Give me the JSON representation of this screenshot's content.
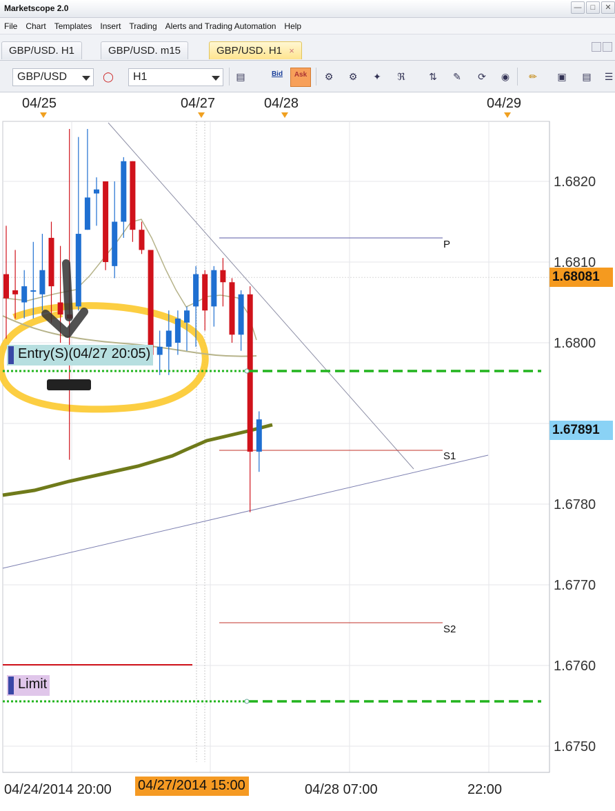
{
  "window": {
    "title": "Marketscope 2.0",
    "buttons": [
      "—",
      "□",
      "✕"
    ]
  },
  "menu": [
    "File",
    "Chart",
    "Templates",
    "Insert",
    "Trading",
    "Alerts and Trading Automation",
    "Help"
  ],
  "tabs": [
    {
      "label": "GBP/USD. H1",
      "active": false
    },
    {
      "label": "GBP/USD. m15",
      "active": false
    },
    {
      "label": "GBP/USD. H1",
      "active": true,
      "close": "×"
    }
  ],
  "toolbar": {
    "symbol": "GBP/USD",
    "period": "H1",
    "bid_label": "Bid",
    "ask_label": "Ask",
    "icons": [
      "line-chart-icon",
      "candle-tool-icon",
      "cursor-tool-icon",
      "zoom-tool-icon",
      "fibonacci-icon",
      "crosshair-icon",
      "alert-icon",
      "refresh-icon",
      "globe-icon",
      "ruler-icon",
      "picture-icon",
      "print-icon",
      "properties-icon"
    ]
  },
  "chart": {
    "top_dates": [
      "04/25",
      "04/27",
      "04/28",
      "04/29"
    ],
    "y_ticks": [
      "1.6820",
      "1.6810",
      "1.6800",
      "1.6780",
      "1.6770",
      "1.6760",
      "1.6750"
    ],
    "bid_price": "1.68081",
    "ask_price": "1.67891",
    "colors": {
      "bid_tag": "#f59a1f",
      "ask_tag": "#8ad2f5",
      "bull": "#1f6fd1",
      "bear": "#d0121b",
      "entry_line": "#22b41e",
      "pivot_line": "#5a5aa6",
      "support_line": "#c0302a",
      "ma_thick": "#6f7a1a",
      "highlight": "#fcc92e"
    },
    "pivot_labels": {
      "p": "P",
      "s1": "S1",
      "s2": "S2"
    },
    "orders": {
      "entry": "Entry(S)(04/27 20:05)",
      "limit": "Limit"
    },
    "x_labels": [
      "04/24/2014 20:00",
      "04/27/2014 15:00",
      "04/28 07:00",
      "22:00"
    ],
    "cursor_time": "04/27/2014 15:00",
    "candles": [
      {
        "o": 1.68085,
        "h": 1.68145,
        "l": 1.68005,
        "c": 1.68055
      },
      {
        "o": 1.68065,
        "h": 1.68115,
        "l": 1.6803,
        "c": 1.6806
      },
      {
        "o": 1.6805,
        "h": 1.6809,
        "l": 1.6803,
        "c": 1.6807
      },
      {
        "o": 1.68065,
        "h": 1.68125,
        "l": 1.6803,
        "c": 1.68065
      },
      {
        "o": 1.6806,
        "h": 1.68135,
        "l": 1.6804,
        "c": 1.6809
      },
      {
        "o": 1.6813,
        "h": 1.6815,
        "l": 1.68025,
        "c": 1.6807
      },
      {
        "o": 1.6805,
        "h": 1.6812,
        "l": 1.68,
        "c": 1.68035
      },
      {
        "o": 1.68035,
        "h": 1.68265,
        "l": 1.67855,
        "c": 1.6803
      },
      {
        "o": 1.68045,
        "h": 1.68255,
        "l": 1.6804,
        "c": 1.68135
      },
      {
        "o": 1.6814,
        "h": 1.68265,
        "l": 1.6814,
        "c": 1.6818
      },
      {
        "o": 1.68185,
        "h": 1.68205,
        "l": 1.68145,
        "c": 1.6819
      },
      {
        "o": 1.682,
        "h": 1.682,
        "l": 1.6809,
        "c": 1.681
      },
      {
        "o": 1.68095,
        "h": 1.682,
        "l": 1.6808,
        "c": 1.6815
      },
      {
        "o": 1.6815,
        "h": 1.6823,
        "l": 1.6813,
        "c": 1.68225
      },
      {
        "o": 1.68225,
        "h": 1.68225,
        "l": 1.68125,
        "c": 1.6814
      },
      {
        "o": 1.6814,
        "h": 1.6815,
        "l": 1.6811,
        "c": 1.68115
      },
      {
        "o": 1.68115,
        "h": 1.68115,
        "l": 1.67985,
        "c": 1.67985
      },
      {
        "o": 1.67985,
        "h": 1.68015,
        "l": 1.6796,
        "c": 1.67995
      },
      {
        "o": 1.67995,
        "h": 1.6804,
        "l": 1.6796,
        "c": 1.68015
      },
      {
        "o": 1.68,
        "h": 1.6804,
        "l": 1.67985,
        "c": 1.6803
      },
      {
        "o": 1.68025,
        "h": 1.68045,
        "l": 1.6799,
        "c": 1.6804
      },
      {
        "o": 1.68045,
        "h": 1.68095,
        "l": 1.67995,
        "c": 1.68085
      },
      {
        "o": 1.68085,
        "h": 1.6809,
        "l": 1.68015,
        "c": 1.6804
      },
      {
        "o": 1.68045,
        "h": 1.68095,
        "l": 1.6802,
        "c": 1.6809
      },
      {
        "o": 1.6809,
        "h": 1.68105,
        "l": 1.68045,
        "c": 1.68075
      },
      {
        "o": 1.68075,
        "h": 1.6808,
        "l": 1.68,
        "c": 1.6801
      },
      {
        "o": 1.6801,
        "h": 1.68065,
        "l": 1.6799,
        "c": 1.6806
      },
      {
        "o": 1.6806,
        "h": 1.6807,
        "l": 1.6779,
        "c": 1.67865
      },
      {
        "o": 1.67865,
        "h": 1.67915,
        "l": 1.6784,
        "c": 1.67905
      }
    ]
  }
}
